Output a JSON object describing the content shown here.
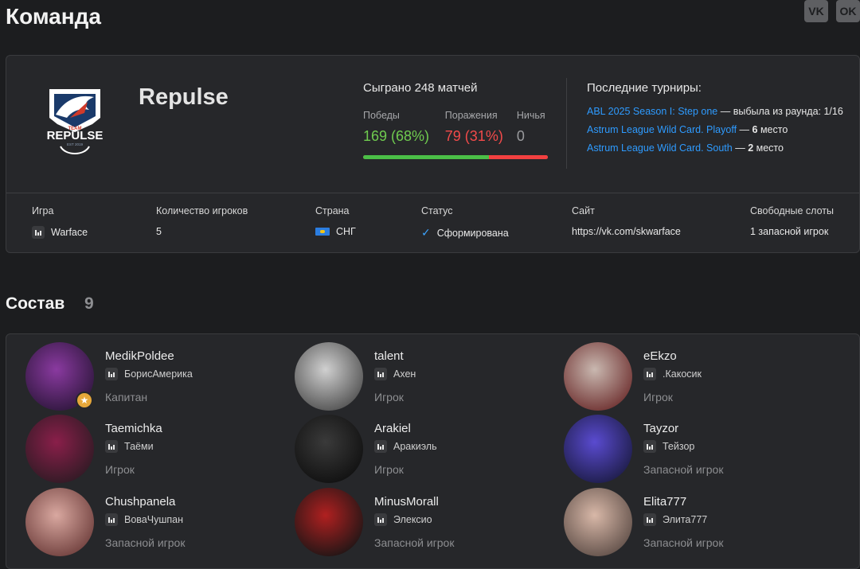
{
  "header": {
    "title": "Команда",
    "social": [
      {
        "icon": "vk-icon",
        "label": "VK"
      },
      {
        "icon": "ok-icon",
        "label": "OK"
      }
    ]
  },
  "team": {
    "name": "Repulse",
    "logo_text": {
      "top": "TEAM",
      "main": "REPULSE",
      "sub": "EST 2019"
    },
    "matches_played": "Сыграно 248 матчей",
    "labels": {
      "wins": "Победы",
      "losses": "Поражения",
      "draws": "Ничья"
    },
    "wins": "169 (68%)",
    "losses": "79 (31%)",
    "draws": "0",
    "win_fraction": 0.68,
    "tournaments_title": "Последние турниры:",
    "tournaments": [
      {
        "name": "ABL 2025 Season I: Step one",
        "sep": " — ",
        "result_prefix": "выбыла из раунда: 1/16",
        "result_bold": ""
      },
      {
        "name": "Astrum League Wild Card. Playoff",
        "sep": " — ",
        "result_prefix": "",
        "result_bold": "6",
        "result_suffix": " место"
      },
      {
        "name": "Astrum League Wild Card. South",
        "sep": " — ",
        "result_prefix": "",
        "result_bold": "2",
        "result_suffix": " место"
      }
    ],
    "info": {
      "game_label": "Игра",
      "game": "Warface",
      "players_label": "Количество игроков",
      "players": "5",
      "country_label": "Страна",
      "country": "СНГ",
      "status_label": "Статус",
      "status": "Сформирована",
      "site_label": "Сайт",
      "site": "https://vk.com/skwarface",
      "slots_label": "Свободные слоты",
      "slots": "1 запасной игрок"
    }
  },
  "roster": {
    "title": "Состав",
    "count": "9",
    "players": [
      {
        "nick": "MedikPoldee",
        "alias": "БорисАмерика",
        "role": "Капитан",
        "captain": true,
        "colors": [
          "#8a3aa0",
          "#2a1538"
        ]
      },
      {
        "nick": "talent",
        "alias": "Ахен",
        "role": "Игрок",
        "captain": false,
        "colors": [
          "#d0d0d0",
          "#4a4a4a"
        ]
      },
      {
        "nick": "eEkzo",
        "alias": ".Какосик",
        "role": "Игрок",
        "captain": false,
        "colors": [
          "#c9b8b0",
          "#6a2a2a"
        ]
      },
      {
        "nick": "Taemichka",
        "alias": "Таёми",
        "role": "Игрок",
        "captain": false,
        "colors": [
          "#8a1f4a",
          "#2a1a22"
        ]
      },
      {
        "nick": "Arakiel",
        "alias": "Аракиэль",
        "role": "Игрок",
        "captain": false,
        "colors": [
          "#3a3a3a",
          "#0e0e0e"
        ]
      },
      {
        "nick": "Tayzor",
        "alias": "Тейзор",
        "role": "Запасной игрок",
        "captain": false,
        "colors": [
          "#5a4bd0",
          "#1a1a40"
        ]
      },
      {
        "nick": "Chushpanela",
        "alias": "ВоваЧушпан",
        "role": "Запасной игрок",
        "captain": false,
        "colors": [
          "#d9a8a0",
          "#6a3a38"
        ]
      },
      {
        "nick": "MinusMorall",
        "alias": "Элексио",
        "role": "Запасной игрок",
        "captain": false,
        "colors": [
          "#b02020",
          "#151515"
        ]
      },
      {
        "nick": "Elita777",
        "alias": "Элита777",
        "role": "Запасной игрок",
        "captain": false,
        "colors": [
          "#d8b8a8",
          "#5a4a44"
        ]
      }
    ]
  }
}
